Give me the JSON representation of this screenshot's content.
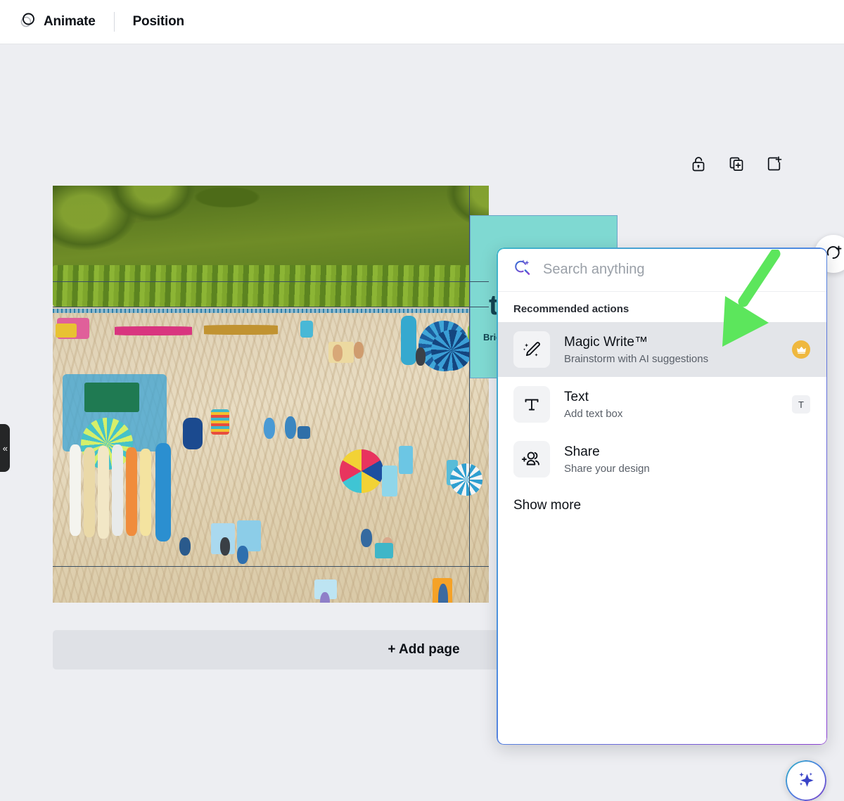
{
  "toolbar": {
    "animate_label": "Animate",
    "animate_icon": "animate-circles-icon",
    "position_label": "Position"
  },
  "page_tools": [
    {
      "name": "lock-open-icon",
      "label": "Unlock"
    },
    {
      "name": "duplicate-page-icon",
      "label": "Duplicate page"
    },
    {
      "name": "add-page-icon",
      "label": "Add page"
    }
  ],
  "canvas": {
    "left_handle_glyph": "«",
    "teal_element": {
      "heading": "t",
      "subtext": "Brie"
    },
    "add_page_label": "+ Add page",
    "rotate_button_icon": "rotate-add-icon"
  },
  "panel": {
    "search": {
      "icon": "magic-search-icon",
      "placeholder": "Search anything",
      "value": ""
    },
    "section_title": "Recommended actions",
    "actions": [
      {
        "title": "Magic Write™",
        "subtitle": "Brainstorm with AI suggestions",
        "icon": "magic-pencil-icon",
        "badge_type": "crown",
        "badge_text": "",
        "selected": true
      },
      {
        "title": "Text",
        "subtitle": "Add text box",
        "icon": "text-t-icon",
        "badge_type": "kbd",
        "badge_text": "T",
        "selected": false
      },
      {
        "title": "Share",
        "subtitle": "Share your design",
        "icon": "add-people-icon",
        "badge_type": "none",
        "badge_text": "",
        "selected": false
      }
    ],
    "show_more_label": "Show more"
  },
  "annotation": {
    "arrow_icon": "green-arrow-icon",
    "arrow_color": "#5ce65c"
  },
  "magic_fab": {
    "icon": "sparkle-icon"
  },
  "colors": {
    "background": "#edeef2",
    "panel_border_start": "#3fb6c8",
    "panel_border_end": "#8b3fd1",
    "selected_row": "#e3e5e9",
    "crown_badge": "#efb83f",
    "teal_element": "#7fd9d2",
    "add_page_bar": "#dfe1e6"
  }
}
